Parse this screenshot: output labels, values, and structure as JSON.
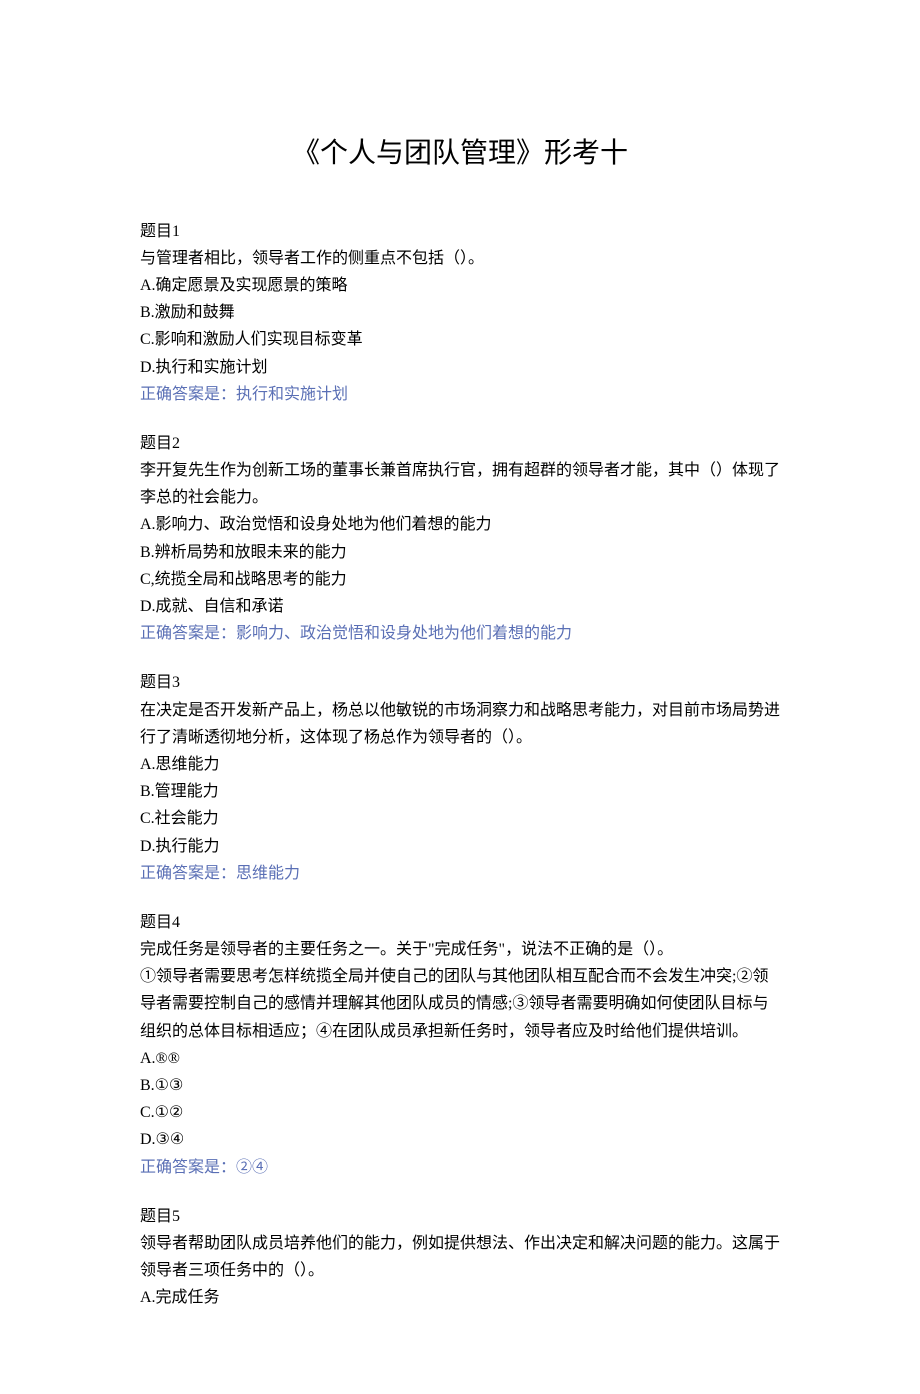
{
  "title": "《个人与团队管理》形考十",
  "questions": [
    {
      "number": "题目1",
      "prompt": "与管理者相比，领导者工作的侧重点不包括（）。",
      "options": [
        "A.确定愿景及实现愿景的策略",
        "B.激励和鼓舞",
        "C.影响和激励人们实现目标变革",
        "D.执行和实施计划"
      ],
      "answer": "正确答案是：执行和实施计划"
    },
    {
      "number": "题目2",
      "prompt": "李开复先生作为创新工场的董事长兼首席执行官，拥有超群的领导者才能，其中（）体现了李总的社会能力。",
      "options": [
        "A.影响力、政治觉悟和设身处地为他们着想的能力",
        "B.辨析局势和放眼未来的能力",
        "C,统揽全局和战略思考的能力",
        "D.成就、自信和承诺"
      ],
      "answer": "正确答案是：影响力、政治觉悟和设身处地为他们着想的能力"
    },
    {
      "number": "题目3",
      "prompt": "在决定是否开发新产品上，杨总以他敏锐的市场洞察力和战略思考能力，对目前市场局势进行了清晰透彻地分析，这体现了杨总作为领导者的（）。",
      "options": [
        "A.思维能力",
        "B.管理能力",
        "C.社会能力",
        "D.执行能力"
      ],
      "answer": "正确答案是：思维能力"
    },
    {
      "number": "题目4",
      "prompt": "完成任务是领导者的主要任务之一。关于\"完成任务\"，说法不正确的是（）。",
      "extra": "①领导者需要思考怎样统揽全局并使自己的团队与其他团队相互配合而不会发生冲突;②领导者需要控制自己的感情并理解其他团队成员的情感;③领导者需要明确如何使团队目标与组织的总体目标相适应；④在团队成员承担新任务时，领导者应及时给他们提供培训。",
      "options": [
        "A.®®",
        "B.①③",
        "C.①②",
        "D.③④"
      ],
      "answer": "正确答案是：②④"
    },
    {
      "number": "题目5",
      "prompt": "领导者帮助团队成员培养他们的能力，例如提供想法、作出决定和解决问题的能力。这属于领导者三项任务中的（）。",
      "options": [
        "A.完成任务"
      ],
      "answer": ""
    }
  ]
}
